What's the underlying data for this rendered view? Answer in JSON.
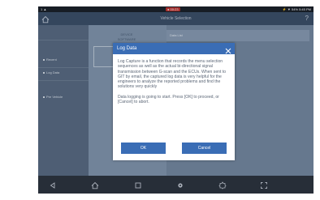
{
  "status_bar": {
    "left_text": "1 ▲",
    "record_badge": "● 00:23",
    "right_text": "⚡ ▼ 54% 5:45 PM"
  },
  "title_bar": {
    "title": "Vehicle Selection",
    "home_icon": "home-icon",
    "help_icon": "help-icon",
    "help_glyph": "?"
  },
  "sidebar": {
    "items": [
      {
        "label": "Recent"
      },
      {
        "label": "Log Data"
      },
      {
        "label": "Pre Vehicle"
      }
    ]
  },
  "main": {
    "tab_top_line1": "DEVICE",
    "tab_top_line2": "SOFTWARE",
    "log_box_label": "Data List"
  },
  "dialog": {
    "title": "Log Data",
    "paragraph1": "Log Capture is a function that records the menu selection sequences as well as the actual bi-directional signal transmission between G-scan and the ECUs. When sent to GIT by email, the captured log data is very helpful for the engineers to analyze the reported problems and find the solutions very quickly",
    "paragraph2": "Data logging is going to start. Press [OK] to proceed, or [Cancel] to abort.",
    "ok_label": "OK",
    "cancel_label": "Cancel"
  },
  "nav_bar": {
    "icons": [
      "back-icon",
      "home-icon",
      "recents-icon",
      "settings-icon",
      "screen-icon",
      "screenshot-icon"
    ]
  },
  "colors": {
    "dialog_header": "#3a6db5",
    "button": "#3a6db5",
    "title_bar": "#3d4f68",
    "background": "#5f6f85"
  }
}
